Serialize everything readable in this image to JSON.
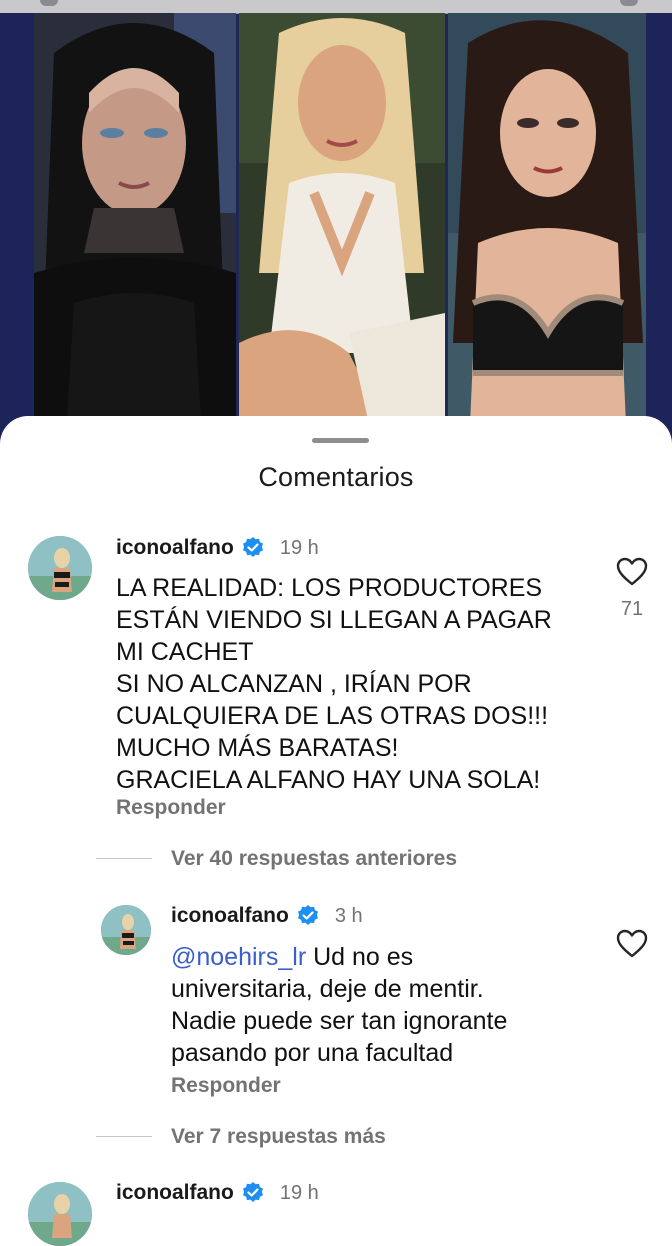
{
  "sheet": {
    "title": "Comentarios"
  },
  "comments": [
    {
      "username": "iconoalfano",
      "verified": true,
      "time": "19 h",
      "text": "LA REALIDAD: LOS PRODUCTORES\nESTÁN VIENDO SI LLEGAN A PAGAR\nMI CACHET\nSI NO ALCANZAN , IRÍAN POR\nCUALQUIERA DE LAS OTRAS DOS!!!\nMUCHO MÁS BARATAS!\nGRACIELA ALFANO HAY UNA SOLA!",
      "reply_label": "Responder",
      "likes": "71",
      "view_previous_replies": "Ver 40 respuestas anteriores",
      "reply": {
        "username": "iconoalfano",
        "verified": true,
        "time": "3 h",
        "mention": "@noehirs_lr",
        "text_first": " Ud no es",
        "text_rest": "universitaria, deje de mentir.\nNadie puede ser tan ignorante\npasando por una facultad",
        "reply_label": "Responder"
      },
      "view_more_replies": "Ver 7 respuestas más"
    },
    {
      "username": "iconoalfano",
      "verified": true,
      "time": "19 h"
    }
  ],
  "colors": {
    "image_background": "#1f2757",
    "verified_badge": "#1d8ff2",
    "mention": "#3a5fcc",
    "secondary_text": "#737373"
  },
  "icons": {
    "like": "heart-outline-icon",
    "verified": "verified-badge-icon"
  }
}
